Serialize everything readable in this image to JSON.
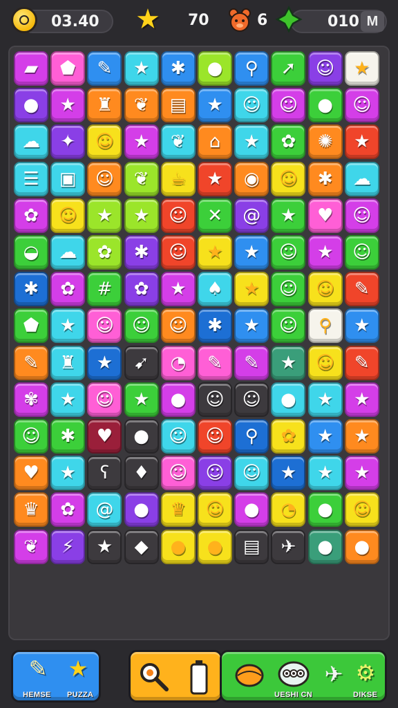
{
  "hud": {
    "timer": "03.40",
    "stars": "70",
    "bear_count": "6",
    "gems": "010",
    "menu_label": "M",
    "timer_icon": "smiley-coin-icon",
    "star_icon": "star-icon",
    "bear_icon": "bear-icon",
    "gem_icon": "leaf-gem-icon"
  },
  "board": {
    "columns": 10,
    "rows": 15,
    "palette": {
      "P": "#d43ee8",
      "K": "#ff5fd6",
      "B": "#2f8ff0",
      "C": "#3fd6ea",
      "G": "#3ccf3a",
      "L": "#9be52a",
      "Y": "#f7e11c",
      "O": "#ff8a1f",
      "R": "#f0452a",
      "V": "#8a3fe6",
      "N": "#1d6fd4",
      "W": "#f6f4ec",
      "D": "#3d3a3e",
      "M": "#9a1f3a",
      "T": "#3a9e7a"
    },
    "tiles": [
      [
        "P",
        "K",
        "B",
        "C",
        "B",
        "L",
        "B",
        "G",
        "V",
        "W"
      ],
      [
        "V",
        "P",
        "O",
        "O",
        "O",
        "B",
        "C",
        "P",
        "G",
        "P"
      ],
      [
        "C",
        "V",
        "Y",
        "P",
        "C",
        "O",
        "C",
        "G",
        "O",
        "R"
      ],
      [
        "C",
        "C",
        "O",
        "L",
        "Y",
        "R",
        "O",
        "Y",
        "O",
        "C"
      ],
      [
        "P",
        "Y",
        "L",
        "L",
        "R",
        "G",
        "V",
        "G",
        "K",
        "P"
      ],
      [
        "G",
        "C",
        "L",
        "V",
        "R",
        "Y",
        "B",
        "G",
        "P",
        "G"
      ],
      [
        "N",
        "P",
        "G",
        "V",
        "P",
        "C",
        "Y",
        "G",
        "Y",
        "R"
      ],
      [
        "G",
        "C",
        "K",
        "G",
        "O",
        "N",
        "B",
        "G",
        "W",
        "B"
      ],
      [
        "O",
        "C",
        "N",
        "D",
        "K",
        "K",
        "P",
        "T",
        "Y",
        "R"
      ],
      [
        "P",
        "C",
        "K",
        "G",
        "P",
        "D",
        "D",
        "C",
        "C",
        "P"
      ],
      [
        "G",
        "G",
        "M",
        "D",
        "C",
        "R",
        "N",
        "Y",
        "B",
        "O"
      ],
      [
        "O",
        "C",
        "D",
        "D",
        "K",
        "V",
        "C",
        "N",
        "C",
        "P"
      ],
      [
        "O",
        "P",
        "C",
        "V",
        "Y",
        "Y",
        "P",
        "Y",
        "G",
        "Y"
      ],
      [
        "P",
        "V",
        "D",
        "D",
        "Y",
        "Y",
        "D",
        "D",
        "T",
        "O"
      ],
      [
        "",
        "",
        "",
        "",
        "",
        "",
        "",
        "",
        "",
        ""
      ]
    ],
    "icons": [
      [
        "eraser-icon",
        "pentagon-icon",
        "pencil-icon",
        "blob-icon",
        "bug-icon",
        "apple-icon",
        "pin-icon",
        "arrow-icon",
        "face-icon",
        "star-icon"
      ],
      [
        "apple-icon",
        "star-icon",
        "chef-icon",
        "leaf-icon",
        "note-icon",
        "star-icon",
        "face-icon",
        "face-icon",
        "apple-icon",
        "face-icon"
      ],
      [
        "cloud-icon",
        "candy-icon",
        "face-icon",
        "star-icon",
        "leaf-icon",
        "house-icon",
        "star-icon",
        "flower-icon",
        "cookie-icon",
        "star-icon"
      ],
      [
        "menu-icon",
        "square-icon",
        "face-icon",
        "leaf-icon",
        "cup-icon",
        "star-icon",
        "ball-icon",
        "face-icon",
        "bug-icon",
        "cloud-icon"
      ],
      [
        "flower-icon",
        "face-icon",
        "star-icon",
        "star-icon",
        "face-icon",
        "cross-icon",
        "spiral-icon",
        "star-icon",
        "heart-icon",
        "face-icon"
      ],
      [
        "lips-icon",
        "cloud-icon",
        "flower-icon",
        "bug-icon",
        "face-icon",
        "star-icon",
        "star-icon",
        "face-icon",
        "star-icon",
        "face-icon"
      ],
      [
        "bug-icon",
        "flower-icon",
        "grid-icon",
        "flower-icon",
        "star-icon",
        "mushroom-icon",
        "star-icon",
        "face-icon",
        "face-icon",
        "pencil-icon"
      ],
      [
        "pentagon-icon",
        "star-icon",
        "face-icon",
        "face-icon",
        "face-icon",
        "bug-icon",
        "star-icon",
        "face-icon",
        "pin-icon",
        "star-icon"
      ],
      [
        "pencil-icon",
        "chef-icon",
        "star-icon",
        "carrot-icon",
        "clock-icon",
        "pencil-icon",
        "pencil-icon",
        "star-icon",
        "face-icon",
        "pencil-icon"
      ],
      [
        "pig-icon",
        "star-icon",
        "face-icon",
        "star-icon",
        "apple-icon",
        "face-icon",
        "face-icon",
        "apple-icon",
        "star-icon",
        "star-icon"
      ],
      [
        "face-icon",
        "bug-icon",
        "heart-icon",
        "orange-icon",
        "face-icon",
        "face-icon",
        "pin-icon",
        "flower-icon",
        "star-icon",
        "star-icon"
      ],
      [
        "heart-icon",
        "star-icon",
        "bear-icon",
        "pear-icon",
        "face-icon",
        "face-icon",
        "face-icon",
        "star-icon",
        "star-icon",
        "star-icon"
      ],
      [
        "tooth-icon",
        "flower-icon",
        "snail-icon",
        "apple-icon",
        "tooth-icon",
        "face-icon",
        "apple-icon",
        "clock-icon",
        "apple-icon",
        "face-icon"
      ],
      [
        "leaf-icon",
        "pepper-icon",
        "star-icon",
        "lemon-icon",
        "orange-icon",
        "orange-icon",
        "note-icon",
        "bird-icon",
        "apple-icon",
        "apple-icon"
      ],
      [
        "",
        "",
        "",
        "",
        "",
        "",
        "",
        "",
        "",
        ""
      ]
    ]
  },
  "bottom": {
    "left_panel": {
      "label_1": "HEMSE",
      "label_2": "PUZZA",
      "icon_1": "pencil-icon",
      "icon_2": "star-icon",
      "color": "#2f8ff0"
    },
    "middle_panel": {
      "icon_1": "magnifier-icon",
      "icon_2": "battery-icon",
      "color": "#ffb21c"
    },
    "right_panel": {
      "label_1": "UESHI CN",
      "label_2": "DIKSE",
      "icon_1": "orange-icon",
      "icon_2": "monster-icon",
      "icon_3": "plane-icon",
      "icon_4": "gear-icon",
      "color": "#3cc83a"
    }
  }
}
